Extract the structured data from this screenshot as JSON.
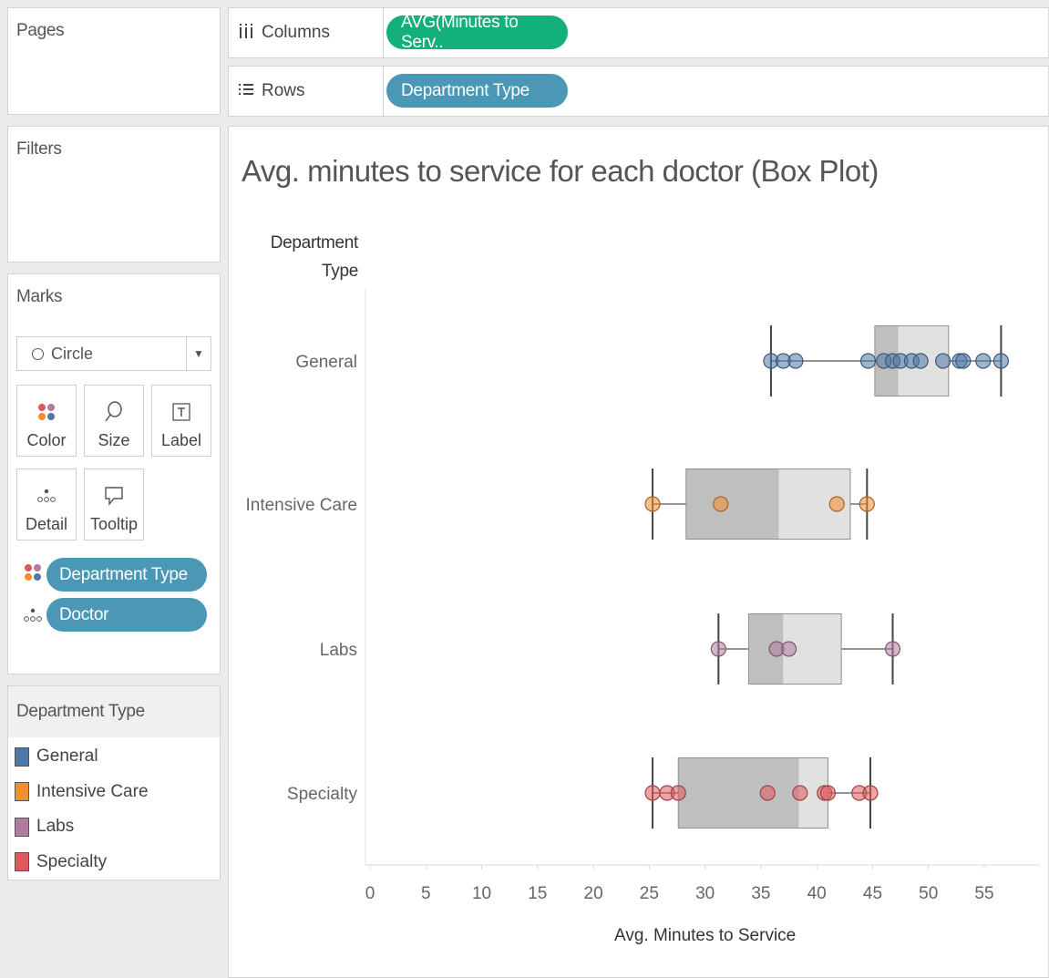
{
  "pages_panel": {
    "title": "Pages"
  },
  "filters_panel": {
    "title": "Filters"
  },
  "columns_shelf": {
    "label": "Columns",
    "pill": "AVG(Minutes to Serv.."
  },
  "rows_shelf": {
    "label": "Rows",
    "pill": "Department Type"
  },
  "marks_panel": {
    "title": "Marks",
    "mark_type": "Circle",
    "buttons": {
      "color": "Color",
      "size": "Size",
      "label": "Label",
      "detail": "Detail",
      "tooltip": "Tooltip"
    },
    "fields": {
      "color_field": "Department Type",
      "detail_field": "Doctor"
    }
  },
  "legend": {
    "title": "Department Type",
    "items": [
      {
        "label": "General",
        "color": "#4e79a7"
      },
      {
        "label": "Intensive Care",
        "color": "#f28e2b"
      },
      {
        "label": "Labs",
        "color": "#b07aa1"
      },
      {
        "label": "Specialty",
        "color": "#e15759"
      }
    ]
  },
  "chart_data": {
    "type": "box",
    "title": "Avg. minutes to service for each doctor (Box Plot)",
    "row_header": "Department Type",
    "xlabel": "Avg. Minutes to Service",
    "xlim": [
      0,
      60
    ],
    "xticks": [
      0,
      5,
      10,
      15,
      20,
      25,
      30,
      35,
      40,
      45,
      50,
      55
    ],
    "grid": false,
    "categories": [
      "General",
      "Intensive Care",
      "Labs",
      "Specialty"
    ],
    "series": [
      {
        "name": "General",
        "color": "#4e79a7",
        "box": {
          "whisker_low": 35.9,
          "q1": 45.2,
          "median": 47.3,
          "q3": 51.8,
          "whisker_high": 56.5
        },
        "points": [
          35.9,
          37.0,
          38.1,
          44.6,
          46.0,
          46.8,
          47.5,
          48.5,
          49.3,
          51.3,
          52.8,
          53.1,
          54.9,
          56.5
        ]
      },
      {
        "name": "Intensive Care",
        "color": "#f28e2b",
        "box": {
          "whisker_low": 25.3,
          "q1": 28.3,
          "median": 36.6,
          "q3": 43.0,
          "whisker_high": 44.5
        },
        "points": [
          25.3,
          31.4,
          41.8,
          44.5
        ]
      },
      {
        "name": "Labs",
        "color": "#b07aa1",
        "box": {
          "whisker_low": 31.2,
          "q1": 33.9,
          "median": 37.0,
          "q3": 42.2,
          "whisker_high": 46.8
        },
        "points": [
          31.2,
          36.4,
          37.5,
          46.8
        ]
      },
      {
        "name": "Specialty",
        "color": "#e15759",
        "box": {
          "whisker_low": 25.3,
          "q1": 27.6,
          "median": 38.4,
          "q3": 41.0,
          "whisker_high": 44.8
        },
        "points": [
          25.3,
          26.6,
          27.6,
          35.6,
          38.5,
          40.7,
          41.0,
          43.8,
          44.8
        ]
      }
    ]
  }
}
